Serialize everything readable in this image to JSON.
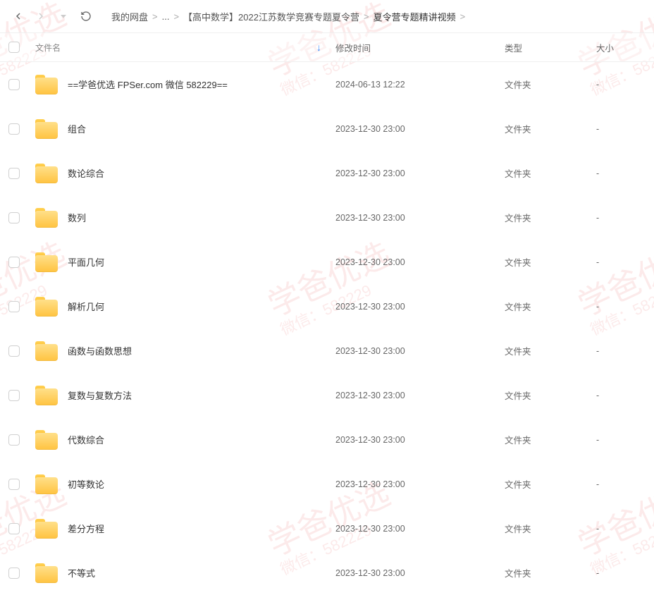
{
  "watermark": {
    "line1": "学爸优选",
    "line2": "微信：582229"
  },
  "breadcrumb": {
    "root": "我的网盘",
    "ellipsis": "...",
    "mid": "【高中数学】2022江苏数学竞赛专题夏令营",
    "current": "夏令营专题精讲视频",
    "sep": ">"
  },
  "columns": {
    "name": "文件名",
    "date": "修改时间",
    "type": "类型",
    "size": "大小"
  },
  "files": [
    {
      "name": "==学爸优选 FPSer.com 微信 582229==",
      "date": "2024-06-13 12:22",
      "type": "文件夹",
      "size": "-"
    },
    {
      "name": "组合",
      "date": "2023-12-30 23:00",
      "type": "文件夹",
      "size": "-"
    },
    {
      "name": "数论综合",
      "date": "2023-12-30 23:00",
      "type": "文件夹",
      "size": "-"
    },
    {
      "name": "数列",
      "date": "2023-12-30 23:00",
      "type": "文件夹",
      "size": "-"
    },
    {
      "name": "平面几何",
      "date": "2023-12-30 23:00",
      "type": "文件夹",
      "size": "-"
    },
    {
      "name": "解析几何",
      "date": "2023-12-30 23:00",
      "type": "文件夹",
      "size": "-"
    },
    {
      "name": "函数与函数思想",
      "date": "2023-12-30 23:00",
      "type": "文件夹",
      "size": "-"
    },
    {
      "name": "复数与复数方法",
      "date": "2023-12-30 23:00",
      "type": "文件夹",
      "size": "-"
    },
    {
      "name": "代数综合",
      "date": "2023-12-30 23:00",
      "type": "文件夹",
      "size": "-"
    },
    {
      "name": "初等数论",
      "date": "2023-12-30 23:00",
      "type": "文件夹",
      "size": "-"
    },
    {
      "name": "差分方程",
      "date": "2023-12-30 23:00",
      "type": "文件夹",
      "size": "-"
    },
    {
      "name": "不等式",
      "date": "2023-12-30 23:00",
      "type": "文件夹",
      "size": "-"
    }
  ]
}
